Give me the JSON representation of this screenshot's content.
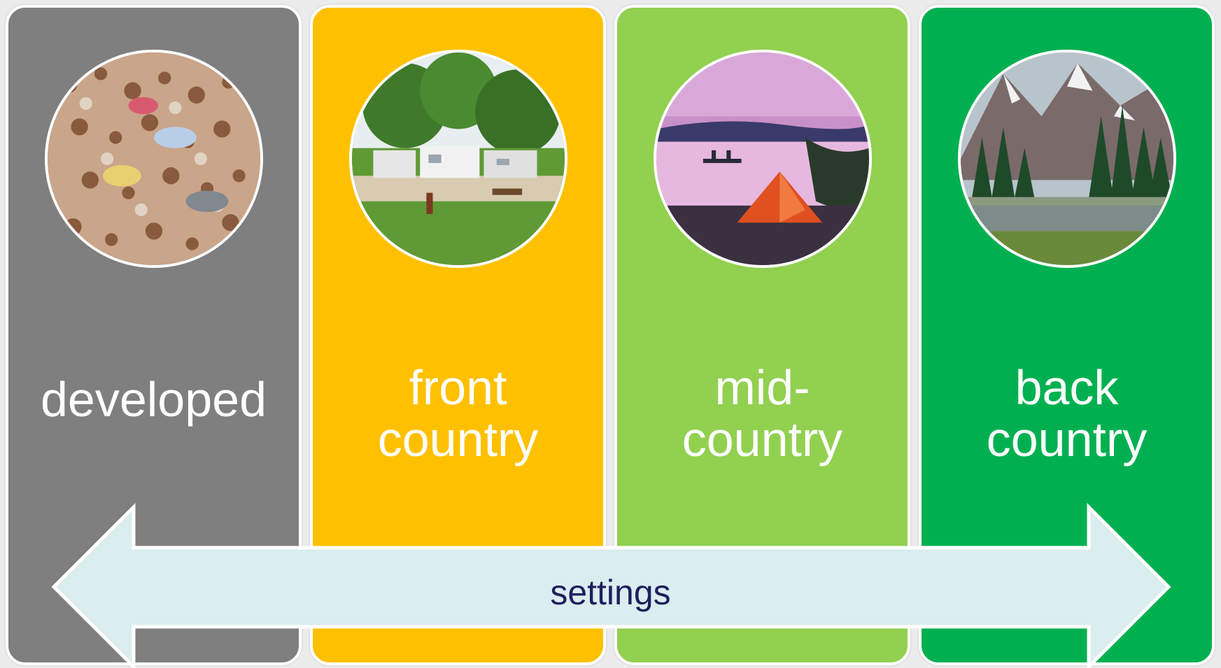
{
  "panels": [
    {
      "label": "developed",
      "color": "#7f7f7f",
      "photo": "crowded-beach"
    },
    {
      "label": "front\ncountry",
      "color": "#ffc000",
      "photo": "rv-campground"
    },
    {
      "label": "mid-\ncountry",
      "color": "#92d050",
      "photo": "lake-tent"
    },
    {
      "label": "back\ncountry",
      "color": "#00b050",
      "photo": "mountain-wilderness"
    }
  ],
  "arrow": {
    "label": "settings",
    "fill": "#daedef"
  }
}
